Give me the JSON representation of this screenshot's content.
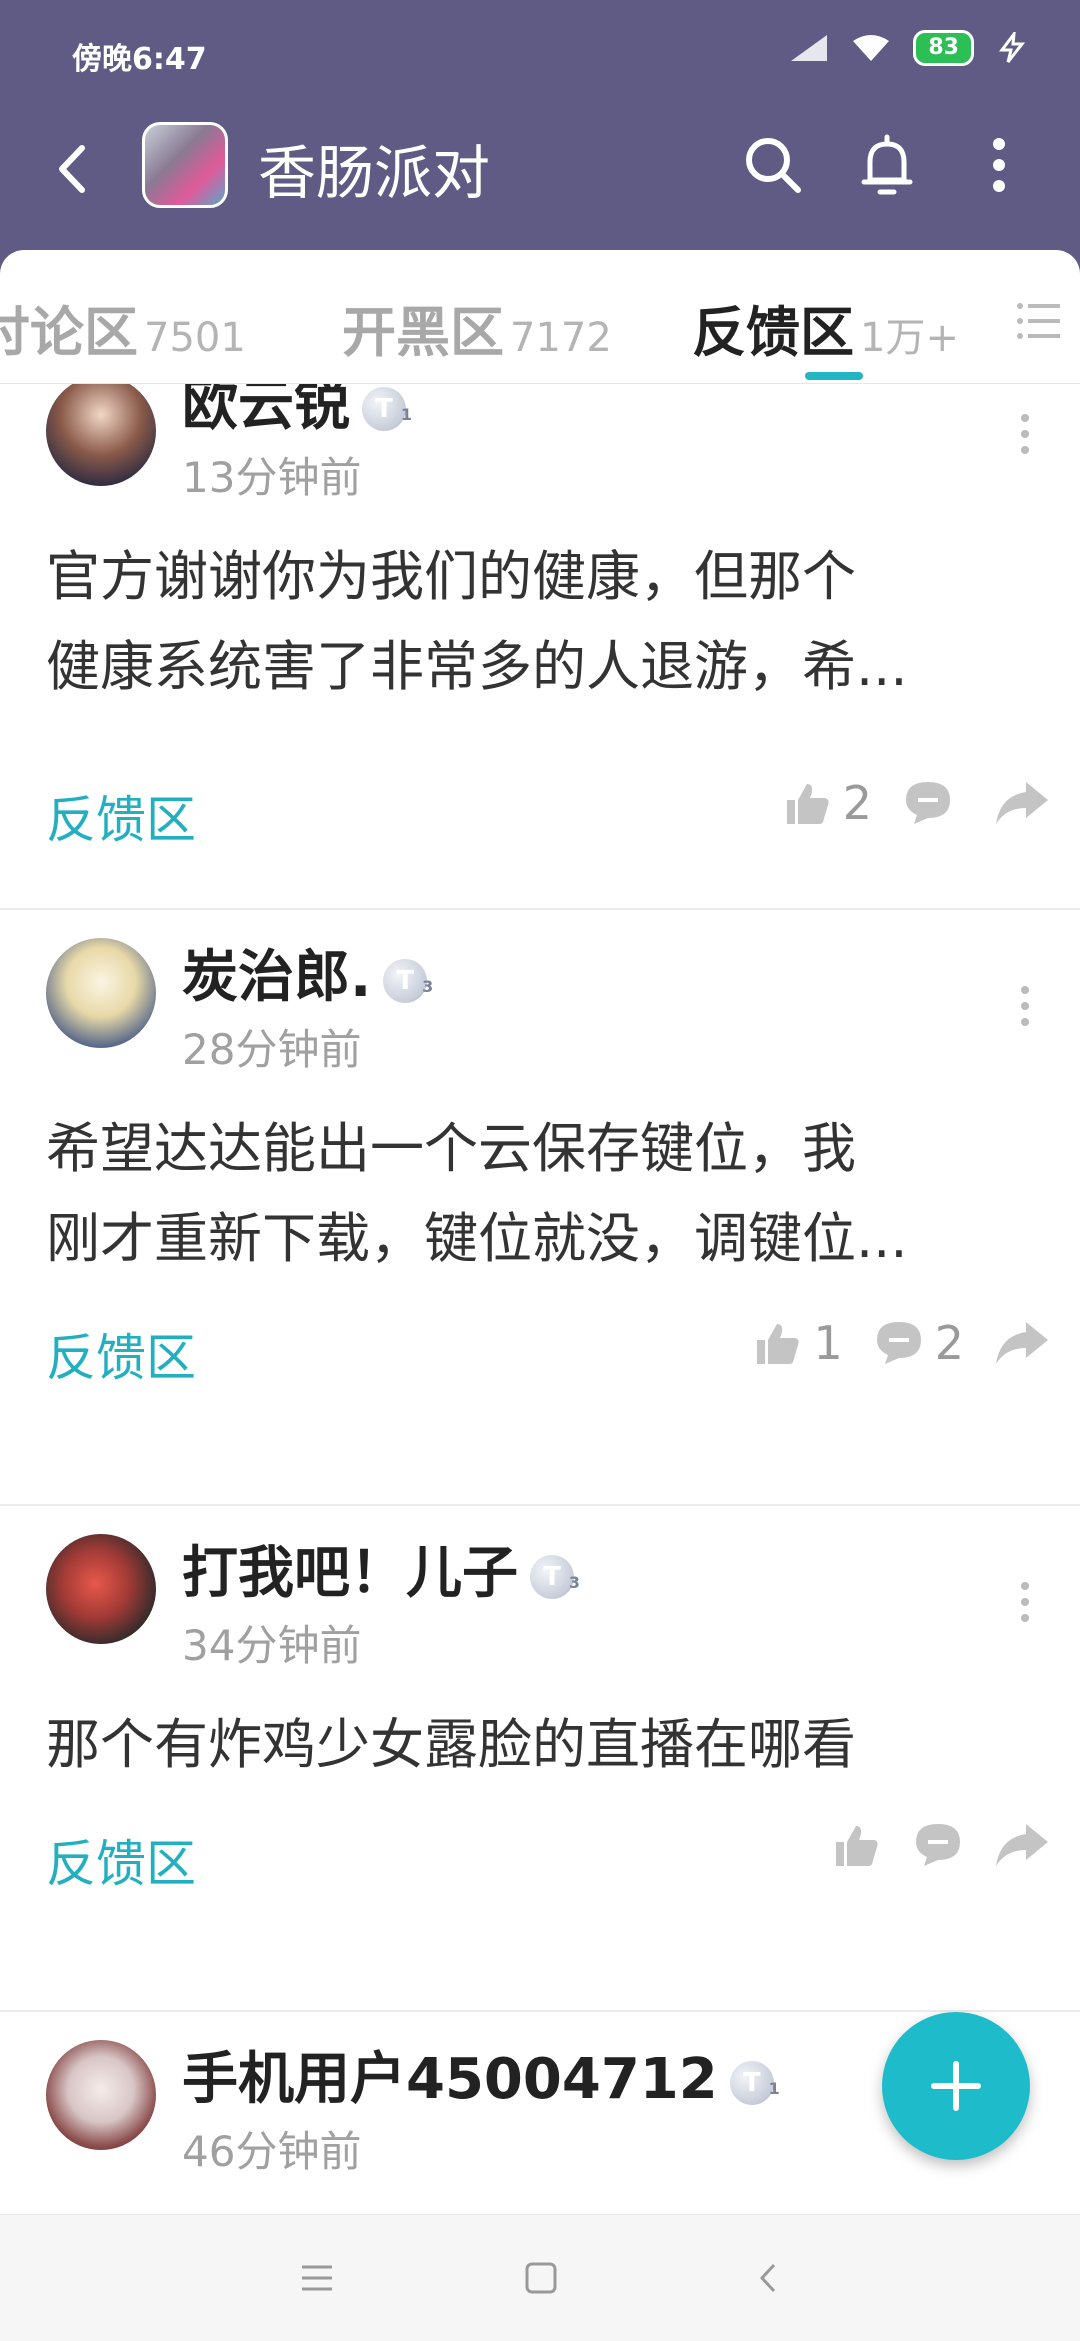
{
  "status_bar": {
    "time": "傍晚6:47",
    "battery": "83",
    "icons": [
      "signal-icon",
      "wifi-icon",
      "battery-icon",
      "charging-icon"
    ]
  },
  "header": {
    "title": "香肠派对",
    "actions": [
      "search-icon",
      "bell-icon",
      "more-vert-icon"
    ]
  },
  "tabs": [
    {
      "label": "讨论区",
      "count": "7501"
    },
    {
      "label": "开黑区",
      "count": "7172"
    },
    {
      "label": "反馈区",
      "count": "1万+",
      "active": true
    }
  ],
  "posts": [
    {
      "user": "欧云锐",
      "level": "1",
      "time": "13分钟前",
      "lines": [
        "官方谢谢你为我们的健康，但那个",
        "健康系统害了非常多的人退游，希..."
      ],
      "section": "反馈区",
      "likes": "2",
      "comments": ""
    },
    {
      "user": "炭治郎.",
      "level": "3",
      "time": "28分钟前",
      "lines": [
        "希望达达能出一个云保存键位，我",
        "刚才重新下载，键位就没，调键位..."
      ],
      "section": "反馈区",
      "likes": "1",
      "comments": "2"
    },
    {
      "user": "打我吧！儿子",
      "level": "3",
      "time": "34分钟前",
      "lines": [
        "那个有炸鸡少女露脸的直播在哪看"
      ],
      "section": "反馈区",
      "likes": "",
      "comments": ""
    },
    {
      "user": "手机用户45004712",
      "level": "1",
      "time": "46分钟前"
    }
  ],
  "colors": {
    "header": "#5f5b85",
    "accent": "#1ebcca",
    "section_link": "#22b0c0"
  }
}
